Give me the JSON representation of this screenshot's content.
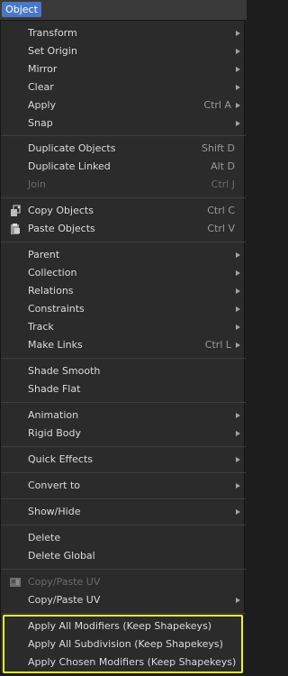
{
  "header": {
    "title": "Object"
  },
  "colors": {
    "accent": "#4a78c8",
    "menu_bg": "#2b2b2b",
    "highlight_border": "#e6f42d"
  },
  "menu": {
    "items": [
      {
        "label": "Transform",
        "submenu": true
      },
      {
        "label": "Set Origin",
        "submenu": true
      },
      {
        "label": "Mirror",
        "submenu": true
      },
      {
        "label": "Clear",
        "submenu": true
      },
      {
        "label": "Apply",
        "shortcut": "Ctrl A",
        "submenu": true
      },
      {
        "label": "Snap",
        "submenu": true
      },
      {
        "label": "Duplicate Objects",
        "shortcut": "Shift D"
      },
      {
        "label": "Duplicate Linked",
        "shortcut": "Alt D"
      },
      {
        "label": "Join",
        "shortcut": "Ctrl J",
        "disabled": true
      },
      {
        "label": "Copy Objects",
        "shortcut": "Ctrl C",
        "icon": "copy-objects-icon"
      },
      {
        "label": "Paste Objects",
        "shortcut": "Ctrl V",
        "icon": "paste-objects-icon"
      },
      {
        "label": "Parent",
        "submenu": true
      },
      {
        "label": "Collection",
        "submenu": true
      },
      {
        "label": "Relations",
        "submenu": true
      },
      {
        "label": "Constraints",
        "submenu": true
      },
      {
        "label": "Track",
        "submenu": true
      },
      {
        "label": "Make Links",
        "shortcut": "Ctrl L",
        "submenu": true
      },
      {
        "label": "Shade Smooth"
      },
      {
        "label": "Shade Flat"
      },
      {
        "label": "Animation",
        "submenu": true
      },
      {
        "label": "Rigid Body",
        "submenu": true
      },
      {
        "label": "Quick Effects",
        "submenu": true
      },
      {
        "label": "Convert to",
        "submenu": true
      },
      {
        "label": "Show/Hide",
        "submenu": true
      },
      {
        "label": "Delete"
      },
      {
        "label": "Delete Global"
      },
      {
        "label": "Copy/Paste UV",
        "disabled": true,
        "icon": "copy-paste-uv-icon"
      },
      {
        "label": "Copy/Paste UV",
        "submenu": true
      },
      {
        "label": "Apply All Modifiers (Keep Shapekeys)"
      },
      {
        "label": "Apply All Subdivision (Keep Shapekeys)"
      },
      {
        "label": "Apply Chosen Modifiers (Keep Shapekeys)"
      }
    ]
  }
}
